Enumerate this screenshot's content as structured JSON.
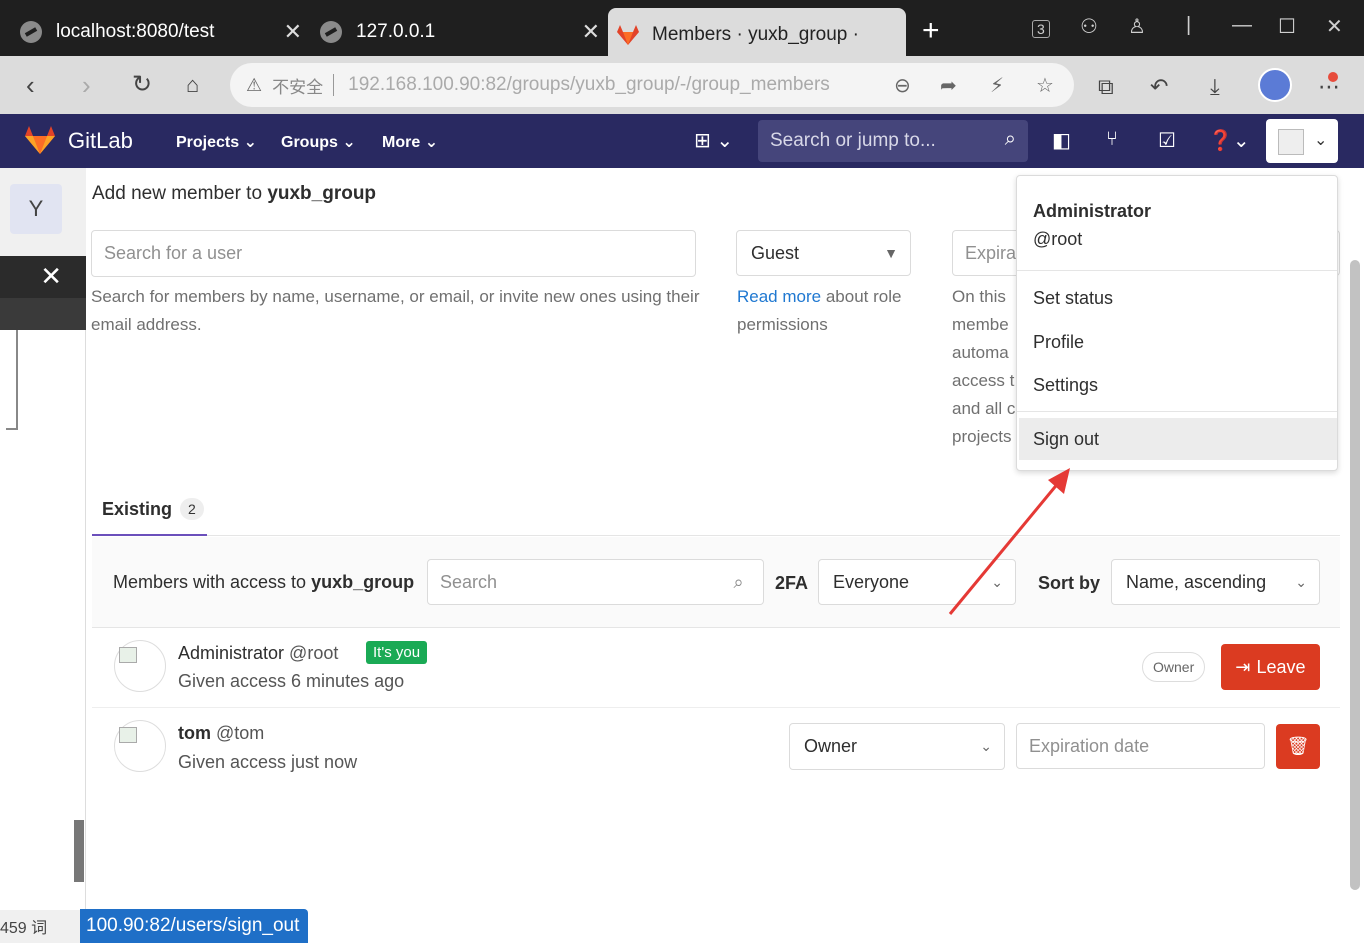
{
  "browser": {
    "tabs": [
      {
        "title": "localhost:8080/test"
      },
      {
        "title": "127.0.0.1"
      },
      {
        "title": "Members · yuxb_group ·"
      }
    ],
    "insecure_label": "不安全",
    "url": "192.168.100.90:82/groups/yuxb_group/-/group_members"
  },
  "gitlab": {
    "brand": "GitLab",
    "menu": {
      "projects": "Projects",
      "groups": "Groups",
      "more": "More"
    },
    "search_placeholder": "Search or jump to..."
  },
  "sidebar": {
    "group_initial": "Y"
  },
  "add_member": {
    "title_prefix": "Add new member to",
    "group_name": "yuxb_group",
    "search_placeholder": "Search for a user",
    "search_help": "Search for members by name, username, or email, or invite new ones using their email address.",
    "role_value": "Guest",
    "read_more": "Read more",
    "role_help": "about role permissions",
    "expiration_placeholder": "Expira",
    "expiration_help_lines": [
      "On this",
      "membe",
      "automa",
      "access t",
      "and all c",
      "projects"
    ]
  },
  "existing": {
    "tab_label": "Existing",
    "count": "2",
    "filter_prefix": "Members with access to",
    "group_name": "yuxb_group",
    "search_placeholder": "Search",
    "twofa_label": "2FA",
    "twofa_value": "Everyone",
    "sort_label": "Sort by",
    "sort_value": "Name, ascending"
  },
  "members": [
    {
      "name": "Administrator",
      "username": "@root",
      "badge": "It's you",
      "access": "Given access 6 minutes ago",
      "role": "Owner",
      "action": "Leave"
    },
    {
      "name": "tom",
      "username": "@tom",
      "access": "Given access just now",
      "role": "Owner",
      "expiration_placeholder": "Expiration date"
    }
  ],
  "user_menu": {
    "name": "Administrator",
    "handle": "@root",
    "items": [
      "Set status",
      "Profile",
      "Settings"
    ],
    "sign_out": "Sign out"
  },
  "status_bar": {
    "word_count": "459 词",
    "hover_url": "100.90:82/users/sign_out"
  },
  "colors": {
    "gitlab_nav": "#292961",
    "danger": "#db3b21",
    "success": "#1aaa55",
    "link": "#1f78d1",
    "annotation_arrow": "#e53935"
  }
}
